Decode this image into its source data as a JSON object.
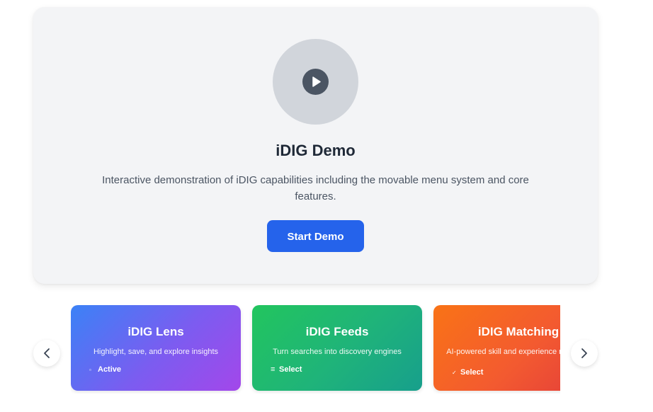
{
  "hero": {
    "title": "iDIG Demo",
    "description": "Interactive demonstration of iDIG capabilities including the movable menu system and core features.",
    "button_label": "Start Demo",
    "play_icon": "play-icon"
  },
  "carousel": {
    "prev_icon": "chevron-left-icon",
    "next_icon": "chevron-right-icon",
    "cards": [
      {
        "title": "iDIG Lens",
        "description": "Highlight, save, and explore insights",
        "status_label": "Active",
        "status_glyph": "▫",
        "status_icon": "square-icon",
        "gradient": [
          "#3b82f6",
          "#a347ea"
        ]
      },
      {
        "title": "iDIG Feeds",
        "description": "Turn searches into discovery engines",
        "status_label": "Select",
        "status_glyph": "≡",
        "status_icon": "list-icon",
        "gradient": [
          "#22c55e",
          "#179f8c"
        ]
      },
      {
        "title": "iDIG Matching",
        "description": "AI-powered skill and experience matching",
        "status_label": "Select",
        "status_glyph": "✓",
        "status_icon": "check-icon",
        "gradient": [
          "#f97316",
          "#e23b3b"
        ]
      }
    ]
  },
  "colors": {
    "primary": "#2563eb",
    "panel": "#f3f4f6",
    "play_circle": "#d1d5db",
    "play_button": "#4b5563"
  }
}
